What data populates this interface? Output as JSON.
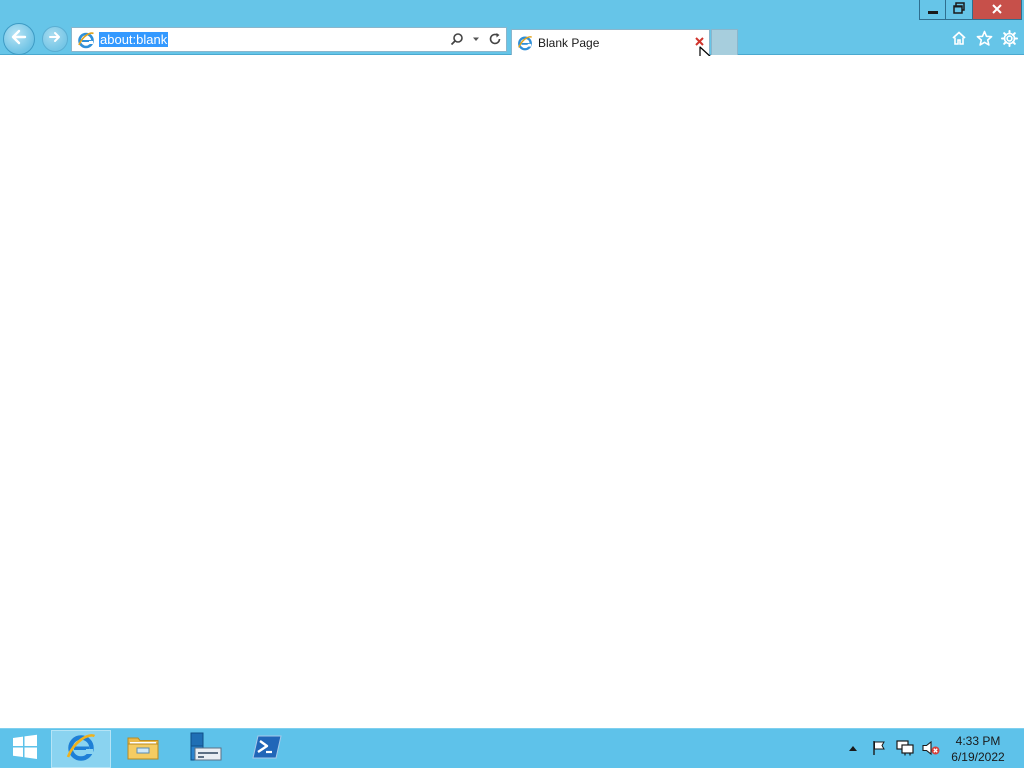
{
  "browser": {
    "address": {
      "url": "about:blank"
    },
    "tab": {
      "title": "Blank Page"
    },
    "window_controls": {
      "minimize_icon": "minimize-icon",
      "restore_icon": "restore-icon",
      "close_icon": "close-icon"
    },
    "toolbar_icons": [
      "home-icon",
      "favorites-star-icon",
      "settings-gear-icon"
    ]
  },
  "taskbar": {
    "pinned": [
      "windows-start-icon",
      "internet-explorer-icon",
      "file-explorer-icon",
      "server-manager-icon",
      "powershell-icon"
    ],
    "tray_icons": [
      "show-hidden-icons-arrow",
      "action-center-flag-icon",
      "network-icon",
      "volume-muted-icon"
    ],
    "clock": {
      "time": "4:33 PM",
      "date": "6/19/2022"
    }
  },
  "colors": {
    "chrome": "#66c5e8",
    "taskbar": "#5ec2ea",
    "close_button": "#c7504a",
    "selection": "#3399ff"
  }
}
